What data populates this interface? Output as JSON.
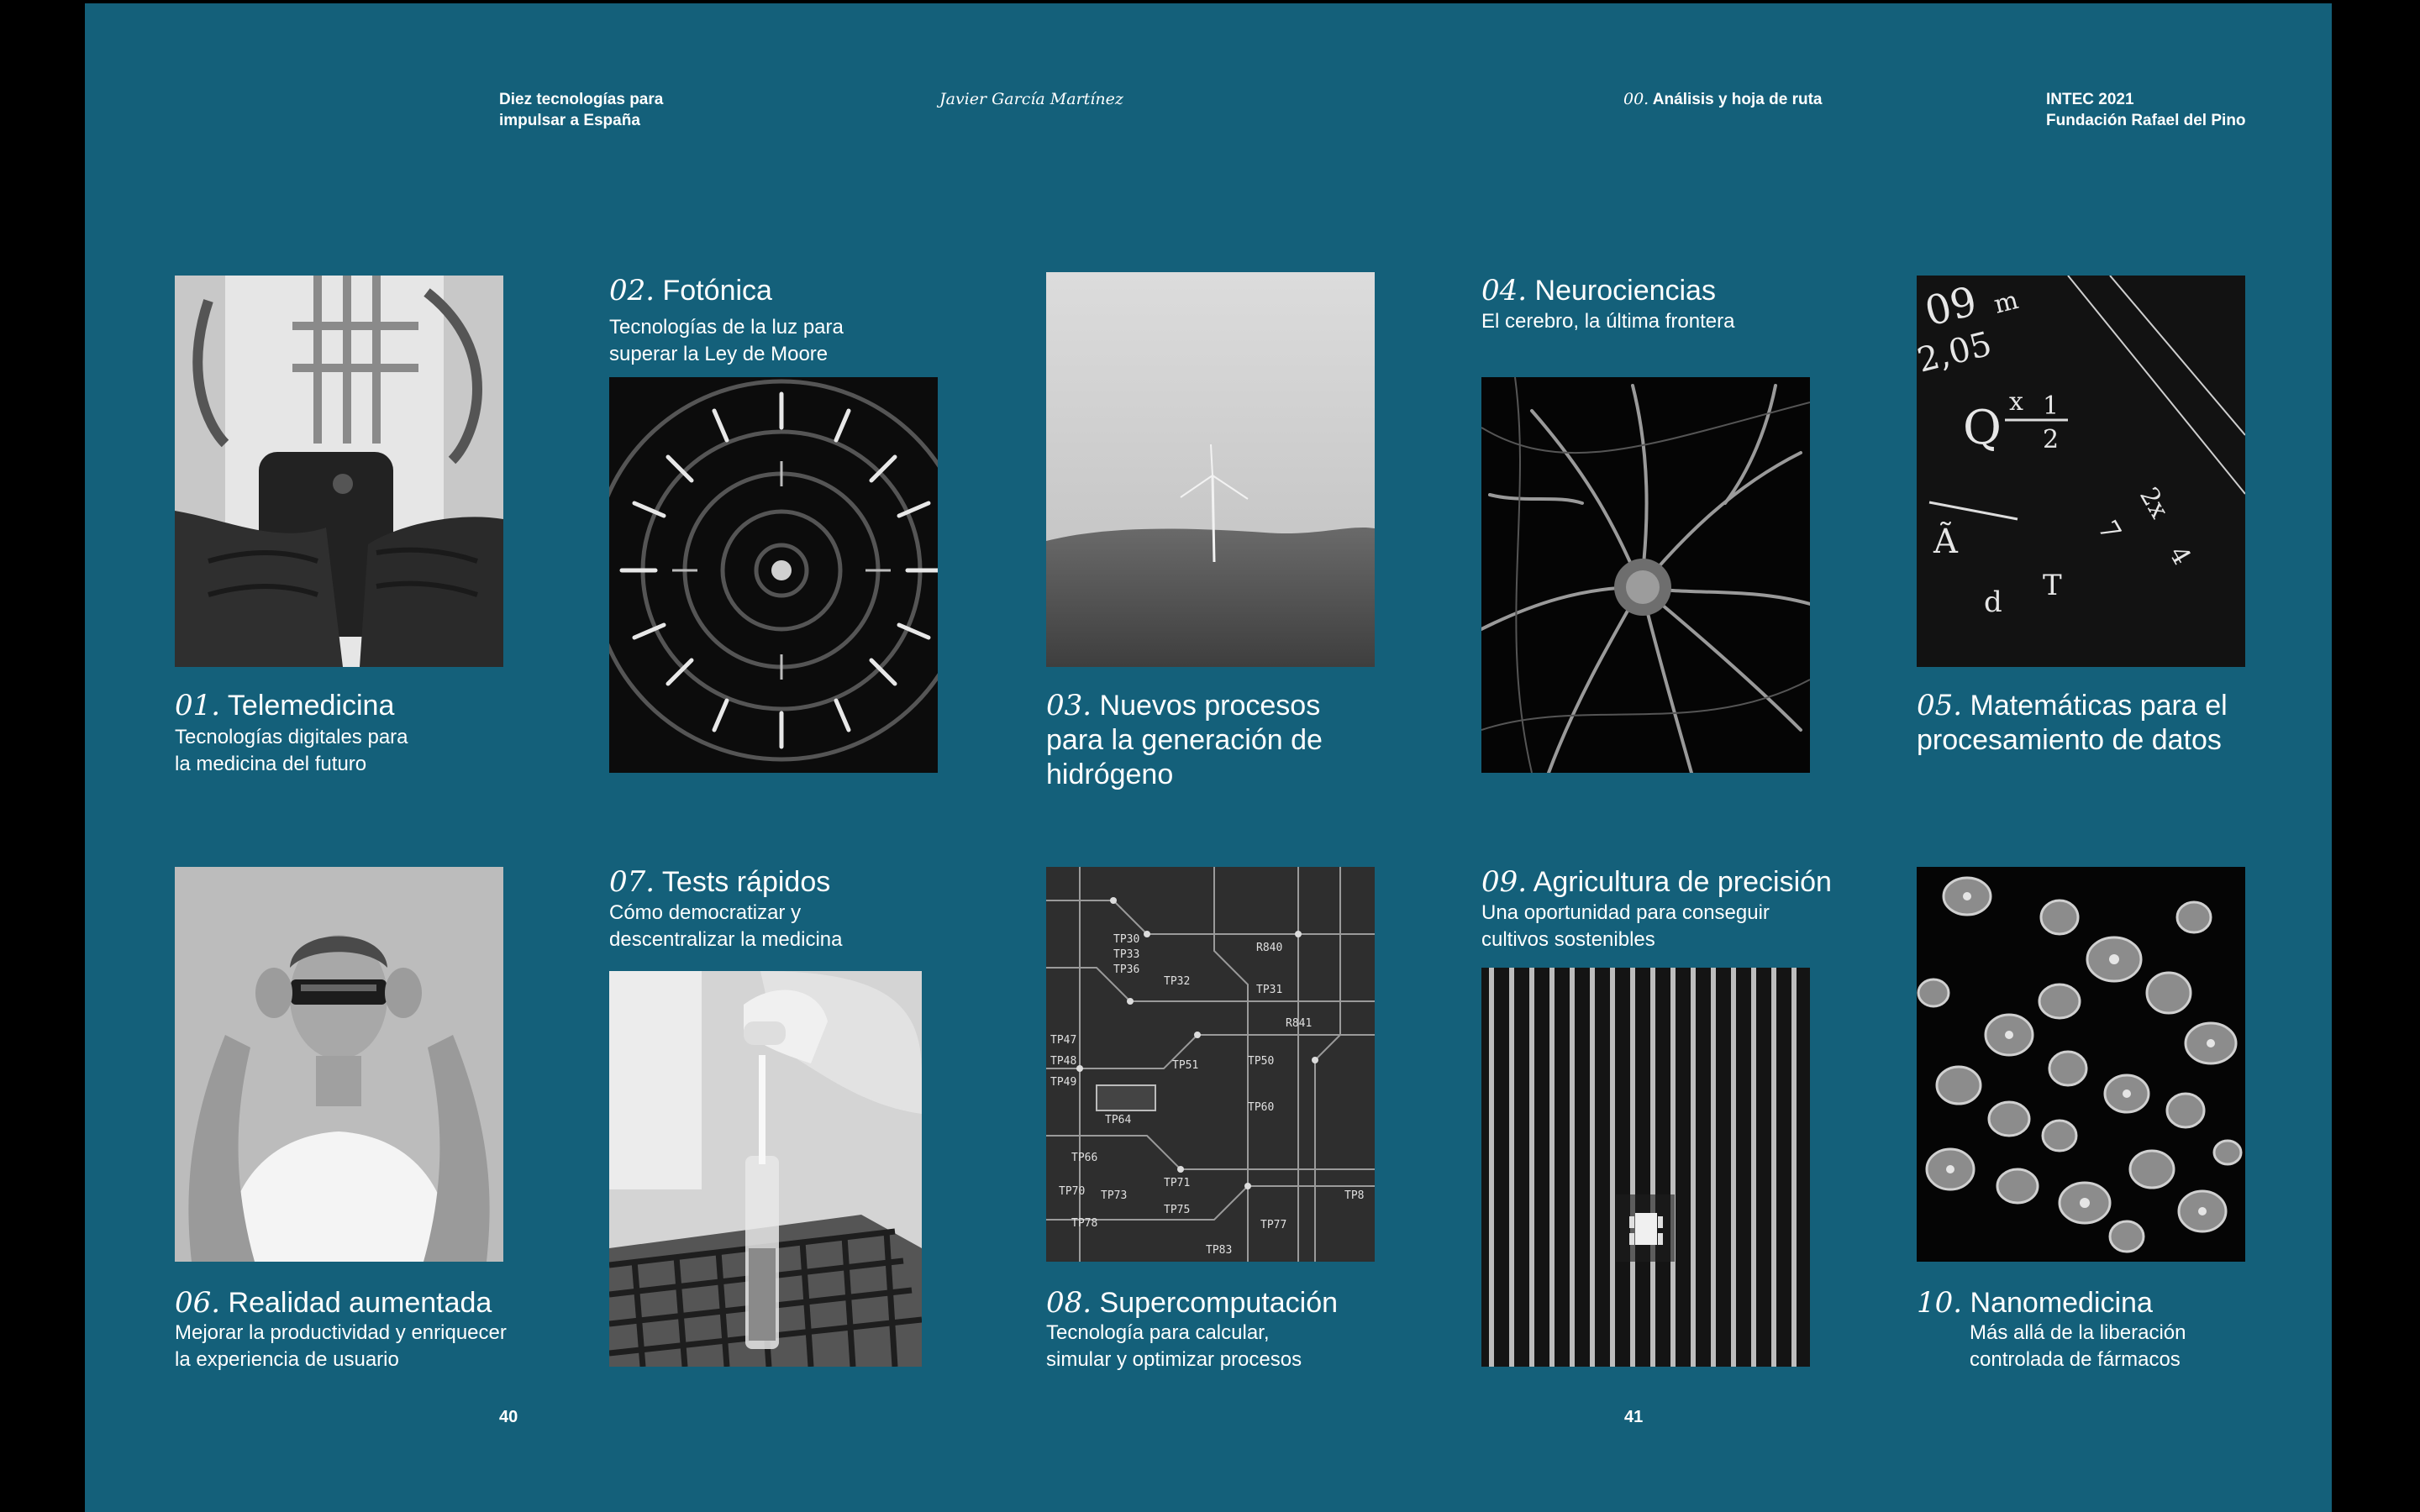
{
  "header": {
    "book_title_line1": "Diez tecnologías para",
    "book_title_line2": "impulsar a España",
    "author": "Javier García Martínez",
    "section_num": "00.",
    "section_title": "Análisis y hoja de ruta",
    "org_line1": "INTEC 2021",
    "org_line2": "Fundación Rafael del Pino"
  },
  "items": [
    {
      "num": "01.",
      "title": "Telemedicina",
      "sub1": "Tecnologías digitales para",
      "sub2": "la medicina del futuro",
      "image": "doctor-smartphone"
    },
    {
      "num": "02.",
      "title": "Fotónica",
      "sub1": "Tecnologías de la luz para",
      "sub2": "superar la Ley de Moore",
      "image": "radial-light-ceiling"
    },
    {
      "num": "03.",
      "title": "Nuevos procesos",
      "title2": "para la generación de",
      "title3": "hidrógeno",
      "image": "wind-turbine-landscape"
    },
    {
      "num": "04.",
      "title": "Neurociencias",
      "sub1": "El cerebro, la última frontera",
      "image": "neuron"
    },
    {
      "num": "05.",
      "title": "Matemáticas para el",
      "title2": "procesamiento de datos",
      "image": "chalkboard-equations"
    },
    {
      "num": "06.",
      "title": "Realidad aumentada",
      "sub1": "Mejorar la productividad y enriquecer",
      "sub2": "la experiencia de usuario",
      "image": "ar-glasses-person"
    },
    {
      "num": "07.",
      "title": "Tests rápidos",
      "sub1": "Cómo democratizar y",
      "sub2": "descentralizar la medicina",
      "image": "test-tube-rack"
    },
    {
      "num": "08.",
      "title": "Supercomputación",
      "sub1": "Tecnología para calcular,",
      "sub2": "simular y optimizar procesos",
      "image": "circuit-board"
    },
    {
      "num": "09.",
      "title": "Agricultura de precisión",
      "sub1": "Una oportunidad para conseguir",
      "sub2": "cultivos sostenibles",
      "image": "aerial-crop-rows"
    },
    {
      "num": "10.",
      "title": "Nanomedicina",
      "sub1": "Más allá de la liberación",
      "sub2": "controlada de fármacos",
      "image": "cells-microscopy"
    }
  ],
  "circuit_labels": [
    "TP30",
    "TP33",
    "TP36",
    "TP32",
    "R840",
    "TP31",
    "R841",
    "TP47",
    "TP48",
    "TP49",
    "TP51",
    "TP50",
    "TP60",
    "TP64",
    "TP66",
    "TP70",
    "TP73",
    "TP71",
    "TP75",
    "TP77",
    "TP78",
    "TP83",
    "TP8"
  ],
  "chalk_labels": [
    "09",
    "m",
    "2,05",
    "x",
    "1",
    "2",
    "Q",
    "7",
    "2x",
    "4",
    "Ã",
    "d",
    "T"
  ],
  "footer": {
    "page_left": "40",
    "page_right": "41"
  }
}
